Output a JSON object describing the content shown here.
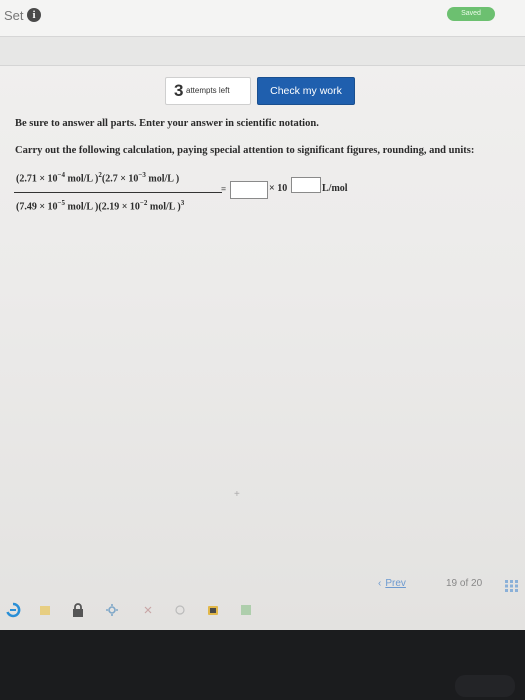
{
  "header": {
    "set_label": "Set",
    "info_icon_glyph": "i",
    "saved_label": "Saved",
    "saved_color": "#6cc070"
  },
  "toolbar": {
    "attempts_count": "3",
    "attempts_text": "attempts left",
    "check_label": "Check my work",
    "check_color": "#1f5fae"
  },
  "instructions": {
    "line1": "Be sure to answer all parts. Enter your answer in scientific notation.",
    "line2": "Carry out the following calculation, paying special attention to significant figures, rounding, and units:"
  },
  "equation": {
    "numerator": {
      "term1_open": "(2.71 × 10",
      "term1_exp": "−4",
      "term1_unit": " mol/L )",
      "term1_power": "2",
      "term2_open": "(2.7 × 10",
      "term2_exp": "−3",
      "term2_unit": " mol/L )"
    },
    "denominator": {
      "term1_open": "(7.49 × 10",
      "term1_exp": "−5",
      "term1_unit": " mol/L )",
      "term2_open": "(2.19 × 10",
      "term2_exp": "−2",
      "term2_unit": " mol/L )",
      "term2_power": "3"
    },
    "equals": "=",
    "times_ten": "× 10",
    "unit": "L/mol",
    "answer_coefficient": "",
    "answer_exponent": ""
  },
  "footer": {
    "prev_arrow": "‹",
    "prev_label": "Prev",
    "current_page": "19",
    "of_label": "of",
    "total_pages": "20"
  },
  "dock": {
    "icons": [
      "browser-icon",
      "notes-icon",
      "lock-icon",
      "settings-icon",
      "close-icon",
      "record-icon",
      "camera-icon",
      "image-icon"
    ]
  }
}
